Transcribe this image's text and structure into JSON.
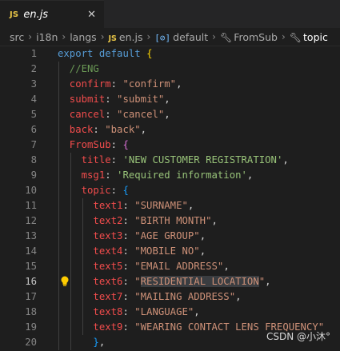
{
  "tab": {
    "badge": "JS",
    "title": "en.js",
    "close": "✕"
  },
  "breadcrumb": {
    "items": [
      "src",
      "i18n",
      "langs",
      "en.js",
      "default",
      "FromSub",
      "topic"
    ],
    "js_badge": "JS",
    "var_icon": "[⊘]"
  },
  "code": {
    "lines": [
      {
        "n": "1",
        "parts": [
          [
            "kw2",
            "export "
          ],
          [
            "kw2",
            "default "
          ],
          [
            "br1",
            "{"
          ]
        ]
      },
      {
        "n": "2",
        "parts": [
          [
            "cm",
            "  //ENG"
          ]
        ]
      },
      {
        "n": "3",
        "parts": [
          [
            "key",
            "  confirm"
          ],
          [
            "pn",
            ": "
          ],
          [
            "str",
            "\"confirm\""
          ],
          [
            "pn",
            ","
          ]
        ]
      },
      {
        "n": "4",
        "parts": [
          [
            "key",
            "  submit"
          ],
          [
            "pn",
            ": "
          ],
          [
            "str",
            "\"submit\""
          ],
          [
            "pn",
            ","
          ]
        ]
      },
      {
        "n": "5",
        "parts": [
          [
            "key",
            "  cancel"
          ],
          [
            "pn",
            ": "
          ],
          [
            "str",
            "\"cancel\""
          ],
          [
            "pn",
            ","
          ]
        ]
      },
      {
        "n": "6",
        "parts": [
          [
            "key",
            "  back"
          ],
          [
            "pn",
            ": "
          ],
          [
            "str",
            "\"back\""
          ],
          [
            "pn",
            ","
          ]
        ]
      },
      {
        "n": "7",
        "parts": [
          [
            "key",
            "  FromSub"
          ],
          [
            "pn",
            ": "
          ],
          [
            "br2",
            "{"
          ]
        ]
      },
      {
        "n": "8",
        "parts": [
          [
            "key",
            "    title"
          ],
          [
            "pn",
            ": "
          ],
          [
            "str2",
            "'NEW CUSTOMER REGISTRATION'"
          ],
          [
            "pn",
            ","
          ]
        ]
      },
      {
        "n": "9",
        "parts": [
          [
            "key",
            "    msg1"
          ],
          [
            "pn",
            ": "
          ],
          [
            "str2",
            "'Required information'"
          ],
          [
            "pn",
            ","
          ]
        ]
      },
      {
        "n": "10",
        "parts": [
          [
            "key",
            "    topic"
          ],
          [
            "pn",
            ": "
          ],
          [
            "br3",
            "{"
          ]
        ]
      },
      {
        "n": "11",
        "parts": [
          [
            "key",
            "      text1"
          ],
          [
            "pn",
            ": "
          ],
          [
            "str",
            "\"SURNAME\""
          ],
          [
            "pn",
            ","
          ]
        ]
      },
      {
        "n": "12",
        "parts": [
          [
            "key",
            "      text2"
          ],
          [
            "pn",
            ": "
          ],
          [
            "str",
            "\"BIRTH MONTH\""
          ],
          [
            "pn",
            ","
          ]
        ]
      },
      {
        "n": "13",
        "parts": [
          [
            "key",
            "      text3"
          ],
          [
            "pn",
            ": "
          ],
          [
            "str",
            "\"AGE GROUP\""
          ],
          [
            "pn",
            ","
          ]
        ]
      },
      {
        "n": "14",
        "parts": [
          [
            "key",
            "      text4"
          ],
          [
            "pn",
            ": "
          ],
          [
            "str",
            "\"MOBILE NO\""
          ],
          [
            "pn",
            ","
          ]
        ]
      },
      {
        "n": "15",
        "parts": [
          [
            "key",
            "      text5"
          ],
          [
            "pn",
            ": "
          ],
          [
            "str",
            "\"EMAIL ADDRESS\""
          ],
          [
            "pn",
            ","
          ]
        ]
      },
      {
        "n": "16",
        "parts": [
          [
            "key",
            "      text6"
          ],
          [
            "pn",
            ": "
          ],
          [
            "str",
            "\""
          ],
          [
            "strhl",
            "RESIDENTIAL LOCATION"
          ],
          [
            "str",
            "\""
          ],
          [
            "pn",
            ","
          ]
        ],
        "active": true,
        "bulb": true
      },
      {
        "n": "17",
        "parts": [
          [
            "key",
            "      text7"
          ],
          [
            "pn",
            ": "
          ],
          [
            "str",
            "\"MAILING ADDRESS\""
          ],
          [
            "pn",
            ","
          ]
        ]
      },
      {
        "n": "18",
        "parts": [
          [
            "key",
            "      text8"
          ],
          [
            "pn",
            ": "
          ],
          [
            "str",
            "\"LANGUAGE\""
          ],
          [
            "pn",
            ","
          ]
        ]
      },
      {
        "n": "19",
        "parts": [
          [
            "key",
            "      text9"
          ],
          [
            "pn",
            ": "
          ],
          [
            "str",
            "\"WEARING CONTACT LENS FREQUENCY\""
          ]
        ]
      },
      {
        "n": "20",
        "parts": [
          [
            "br3",
            "      }"
          ],
          [
            "pn",
            ","
          ]
        ]
      }
    ]
  },
  "watermark": "CSDN @小沐°",
  "colors": {
    "background": "#1e1e1e",
    "keyword": "#569cd6",
    "property": "#f14c4c",
    "string": "#ce9178",
    "comment": "#6a9955"
  }
}
